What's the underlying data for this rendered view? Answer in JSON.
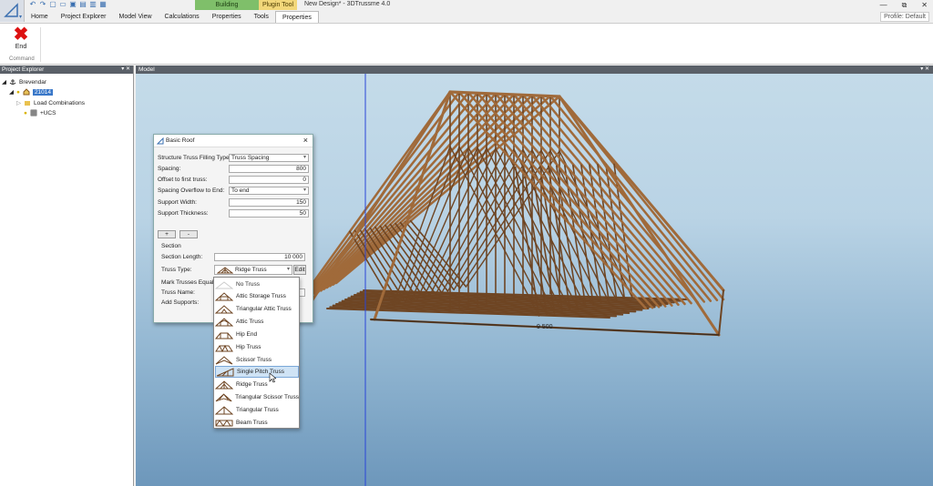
{
  "title_bar": {
    "window_title": "New Design* - 3DTrussme 4.0",
    "context_tabs": [
      "Building",
      "Plugin Tool"
    ],
    "controls": [
      "—",
      "⧉",
      "✕"
    ]
  },
  "tabs": [
    "Home",
    "Project Explorer",
    "Model View",
    "Calculations",
    "Properties",
    "Tools",
    "Properties"
  ],
  "active_tab_index": 6,
  "profile": "Profile: Default",
  "ribbon": {
    "end_label": "End",
    "group_label": "Command"
  },
  "project_explorer": {
    "title": "Project Explorer",
    "items": [
      {
        "label": "Brevendar",
        "icon": "anchor-icon"
      },
      {
        "label": "21014",
        "icon": "house-icon"
      },
      {
        "label": "Load Combinations",
        "icon": "folder-icon"
      },
      {
        "label": "+UCS",
        "icon": "grid-icon"
      }
    ]
  },
  "model": {
    "title": "Model",
    "dimension_label": "9 500"
  },
  "dialog": {
    "title": "Basic Roof",
    "fields": [
      {
        "label": "Structure Truss Filling Type:",
        "value": "Truss Spacing",
        "kind": "select"
      },
      {
        "label": "Spacing:",
        "value": "800",
        "kind": "number"
      },
      {
        "label": "Offset to first truss:",
        "value": "0",
        "kind": "number"
      },
      {
        "label": "Spacing Overflow to End:",
        "value": "To end",
        "kind": "select"
      },
      {
        "label": "Support Width:",
        "value": "150",
        "kind": "number"
      },
      {
        "label": "Support Thickness:",
        "value": "50",
        "kind": "number"
      }
    ],
    "add_button": "+",
    "remove_button": "-",
    "section_label": "Section",
    "section_length_label": "Section Length:",
    "section_length_value": "10 000",
    "truss_type_label": "Truss Type:",
    "truss_type_value": "Ridge Truss",
    "edit_button": "Edit",
    "mark_trusses_label": "Mark Trusses Equal:",
    "truss_name_label": "Truss Name:",
    "add_supports_label": "Add Supports:"
  },
  "truss_dropdown": {
    "options": [
      "No Truss",
      "Attic Storage Truss",
      "Triangular Attic Truss",
      "Attic Truss",
      "Hip End",
      "Hip Truss",
      "Scissor Truss",
      "Single Pitch Truss",
      "Ridge Truss",
      "Triangular Scissor Truss",
      "Triangular Truss",
      "Beam Truss"
    ],
    "highlighted": "Single Pitch Truss"
  },
  "colors": {
    "timber": "#a06a3a",
    "timber_dark": "#6e4523",
    "axis_blue": "#2a45d8",
    "highlight": "#cfe3f5"
  }
}
